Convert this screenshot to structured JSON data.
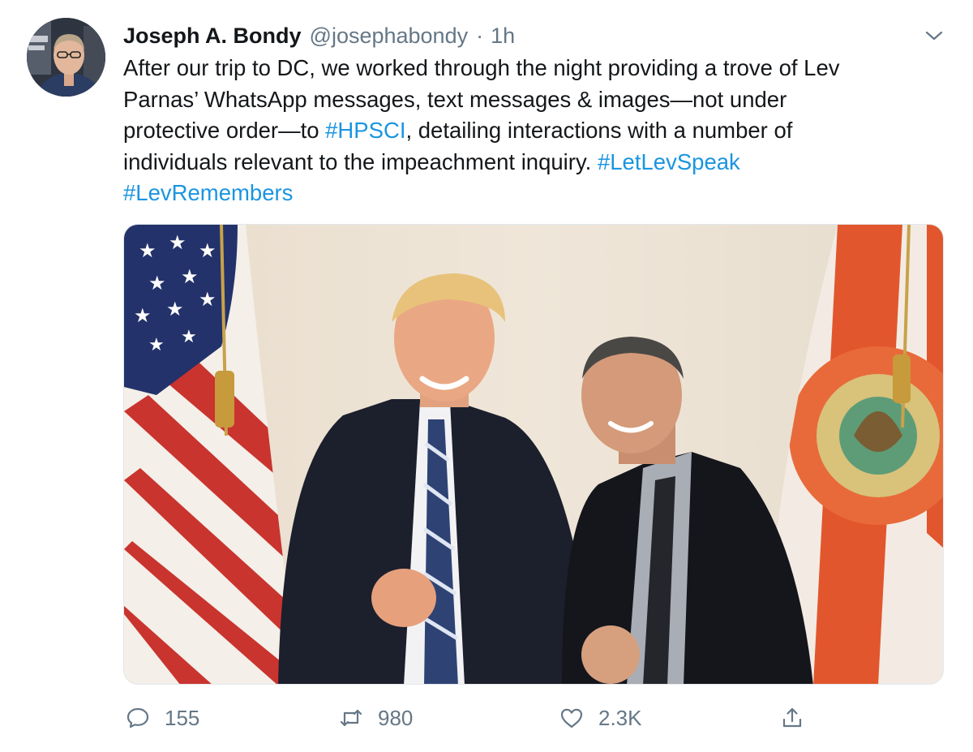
{
  "tweet": {
    "author_name": "Joseph A. Bondy",
    "author_handle": "@josephabondy",
    "separator": "·",
    "time": "1h",
    "text_lines": [
      [
        {
          "t": "After our trip to DC, we worked through the night providing a trove of Lev"
        }
      ],
      [
        {
          "t": "Parnas’ WhatsApp messages, text messages & images—not under"
        }
      ],
      [
        {
          "t": "protective order—to "
        },
        {
          "t": "#HPSCI",
          "tag": true
        },
        {
          "t": ", detailing interactions with a number of"
        }
      ],
      [
        {
          "t": "individuals relevant to the impeachment inquiry. "
        },
        {
          "t": "#LetLevSpeak",
          "tag": true
        }
      ],
      [
        {
          "t": "#LevRemembers",
          "tag": true
        }
      ]
    ],
    "hashtag_color": "#1b95e0"
  },
  "actions": {
    "replies": "155",
    "retweets": "980",
    "likes": "2.3K"
  },
  "icons": {
    "caret": "chevron-down-icon",
    "reply": "reply-bubble-icon",
    "retweet": "retweet-icon",
    "like": "heart-icon",
    "share": "share-icon"
  },
  "colors": {
    "text": "#14171a",
    "muted": "#657786",
    "link": "#1b95e0"
  }
}
